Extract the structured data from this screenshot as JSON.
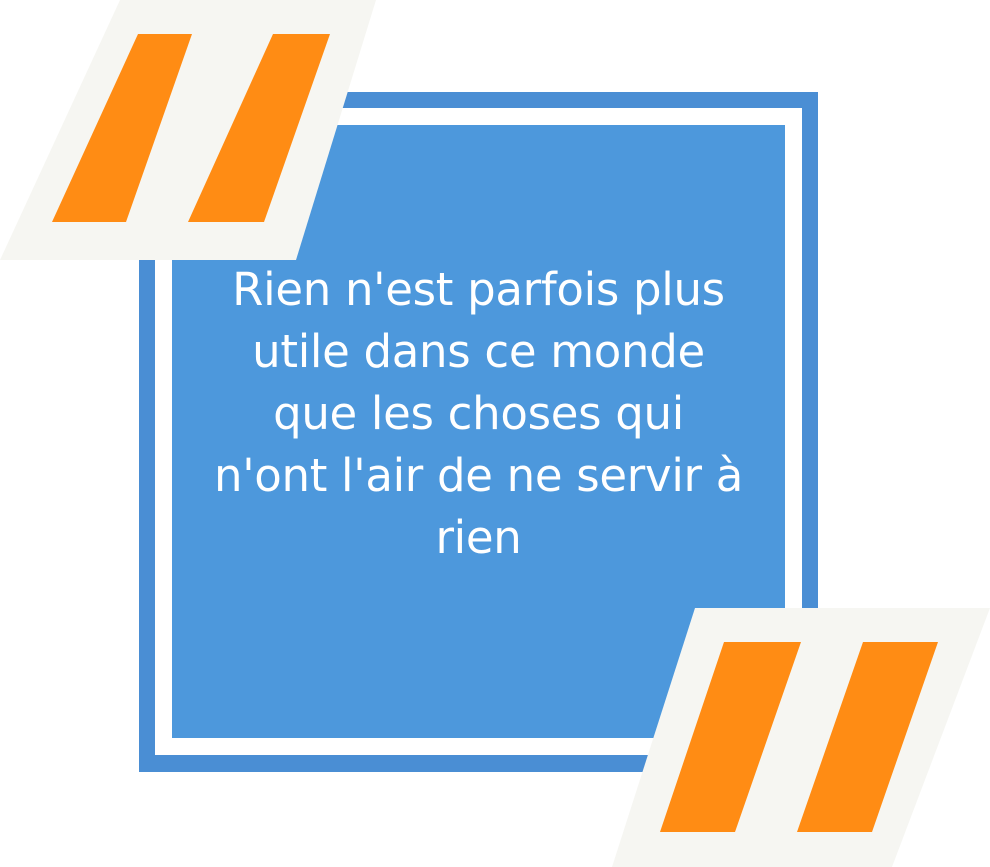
{
  "quote": {
    "text": "Rien n'est parfois plus utile dans ce monde que les choses qui n'ont l'air de ne servir à rien"
  },
  "colors": {
    "frame_blue": "#4A8ED4",
    "inner_blue": "#4D98DC",
    "gap_white": "#FFFFFF",
    "quote_mark_orange": "#FF8C14",
    "quote_mark_backdrop": "#F6F6F2",
    "text": "#FFFFFF"
  },
  "icons": {
    "open_quote": "open-quote-mark-icon",
    "close_quote": "close-quote-mark-icon"
  }
}
